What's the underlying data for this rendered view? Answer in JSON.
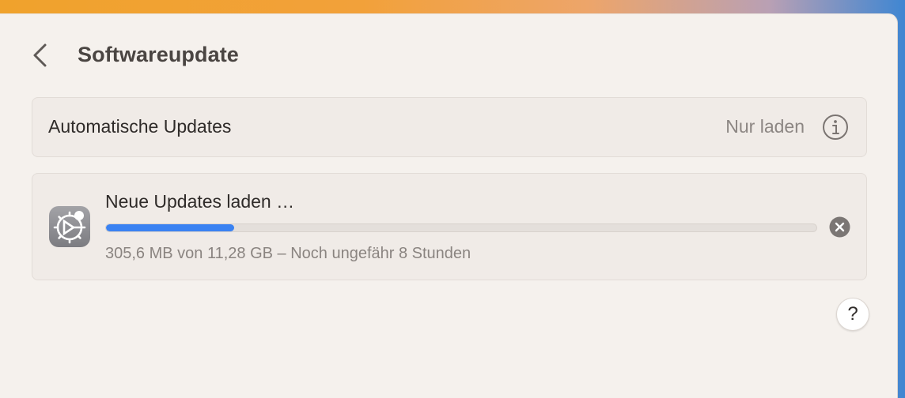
{
  "header": {
    "title": "Softwareupdate"
  },
  "automatic_updates": {
    "label": "Automatische Updates",
    "value": "Nur laden"
  },
  "download": {
    "title": "Neue Updates laden …",
    "status": "305,6 MB von 11,28 GB – Noch ungefähr 8 Stunden",
    "progress_fraction": 0.18
  },
  "help": {
    "label": "?"
  },
  "colors": {
    "accent": "#3a82f2",
    "background": "#f5f1ed",
    "card": "#f0ebe7",
    "icon_gray": "#8e8e93"
  },
  "icons": {
    "back": "chevron-left-icon",
    "info": "info-circle-icon",
    "app": "software-update-gear-icon",
    "cancel": "close-circle-icon"
  }
}
